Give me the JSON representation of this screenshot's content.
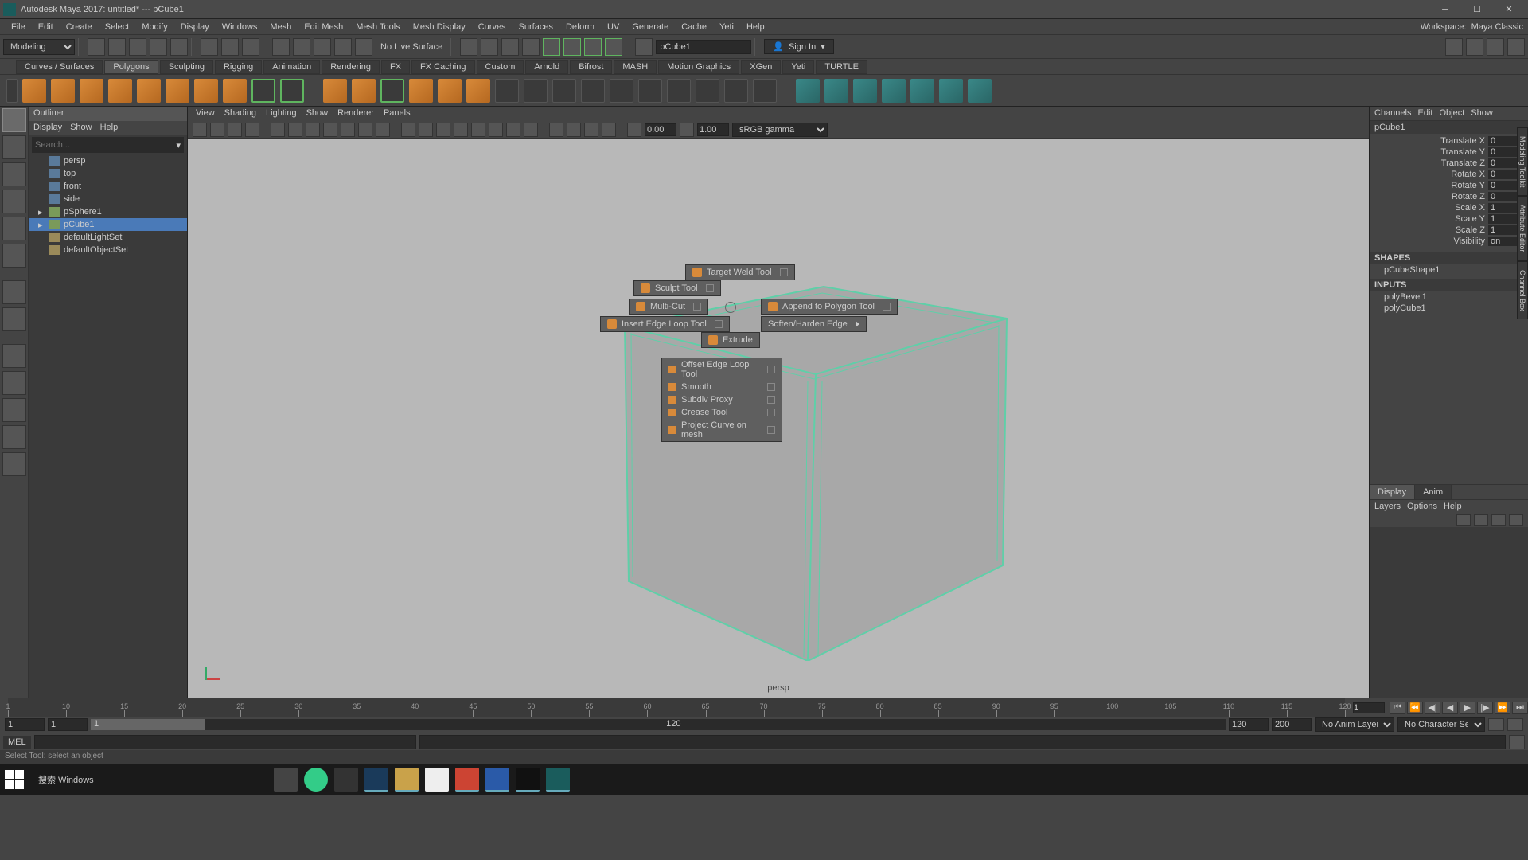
{
  "titlebar": {
    "text": "Autodesk Maya 2017: untitled*  ---  pCube1"
  },
  "menubar": {
    "items": [
      "File",
      "Edit",
      "Create",
      "Select",
      "Modify",
      "Display",
      "Windows",
      "Mesh",
      "Edit Mesh",
      "Mesh Tools",
      "Mesh Display",
      "Curves",
      "Surfaces",
      "Deform",
      "UV",
      "Generate",
      "Cache",
      "Yeti",
      "Help"
    ],
    "workspace_label": "Workspace:",
    "workspace_value": "Maya Classic"
  },
  "statusline": {
    "mode": "Modeling",
    "live_surface": "No Live Surface",
    "name_field": "pCube1",
    "signin": "Sign In"
  },
  "shelftabs": [
    "Curves / Surfaces",
    "Polygons",
    "Sculpting",
    "Rigging",
    "Animation",
    "Rendering",
    "FX",
    "FX Caching",
    "Custom",
    "Arnold",
    "Bifrost",
    "MASH",
    "Motion Graphics",
    "XGen",
    "Yeti",
    "TURTLE"
  ],
  "shelf_active": "Polygons",
  "outliner": {
    "title": "Outliner",
    "menu": [
      "Display",
      "Show",
      "Help"
    ],
    "search_placeholder": "Search...",
    "items": [
      {
        "name": "persp",
        "type": "cam"
      },
      {
        "name": "top",
        "type": "cam"
      },
      {
        "name": "front",
        "type": "cam"
      },
      {
        "name": "side",
        "type": "cam"
      },
      {
        "name": "pSphere1",
        "type": "shape",
        "expandable": true
      },
      {
        "name": "pCube1",
        "type": "shape",
        "selected": true,
        "expandable": true
      },
      {
        "name": "defaultLightSet",
        "type": "set"
      },
      {
        "name": "defaultObjectSet",
        "type": "set"
      }
    ]
  },
  "viewport": {
    "menu": [
      "View",
      "Shading",
      "Lighting",
      "Show",
      "Renderer",
      "Panels"
    ],
    "exposure": "0.00",
    "gamma": "1.00",
    "colorspace": "sRGB gamma",
    "camera_label": "persp"
  },
  "marking_menu": {
    "radial": {
      "n": "Target Weld Tool",
      "nw": "Sculpt Tool",
      "w": "Multi-Cut",
      "sw": "Insert Edge Loop Tool",
      "s": "Extrude",
      "e": "Append to Polygon Tool",
      "se": "Soften/Harden Edge"
    },
    "list": [
      "Offset Edge Loop Tool",
      "Smooth",
      "Subdiv Proxy",
      "Crease Tool",
      "Project Curve on mesh"
    ]
  },
  "channelbox": {
    "menu": [
      "Channels",
      "Edit",
      "Object",
      "Show"
    ],
    "node": "pCube1",
    "attrs": [
      {
        "label": "Translate X",
        "val": "0"
      },
      {
        "label": "Translate Y",
        "val": "0"
      },
      {
        "label": "Translate Z",
        "val": "0"
      },
      {
        "label": "Rotate X",
        "val": "0"
      },
      {
        "label": "Rotate Y",
        "val": "0"
      },
      {
        "label": "Rotate Z",
        "val": "0"
      },
      {
        "label": "Scale X",
        "val": "1"
      },
      {
        "label": "Scale Y",
        "val": "1"
      },
      {
        "label": "Scale Z",
        "val": "1"
      },
      {
        "label": "Visibility",
        "val": "on"
      }
    ],
    "shapes_label": "SHAPES",
    "shape_node": "pCubeShape1",
    "inputs_label": "INPUTS",
    "input_nodes": [
      "polyBevel1",
      "polyCube1"
    ],
    "tabs": [
      "Display",
      "Anim"
    ],
    "layermenu": [
      "Layers",
      "Options",
      "Help"
    ]
  },
  "timeline": {
    "ticks": [
      1,
      10,
      15,
      20,
      25,
      30,
      35,
      40,
      45,
      50,
      55,
      60,
      65,
      70,
      75,
      80,
      85,
      90,
      95,
      100,
      105,
      110,
      115,
      120
    ],
    "current": "1",
    "slider": {
      "start": "1",
      "end": "1",
      "dispstart": "1",
      "rangeend": "120",
      "fullstart": "120",
      "fullend": "200"
    },
    "animlayer": "No Anim Layer",
    "charset": "No Character Set"
  },
  "cmdline": {
    "lang": "MEL",
    "value": ""
  },
  "helpline": "Select Tool: select an object",
  "taskbar": {
    "search": "搜索 Windows"
  }
}
